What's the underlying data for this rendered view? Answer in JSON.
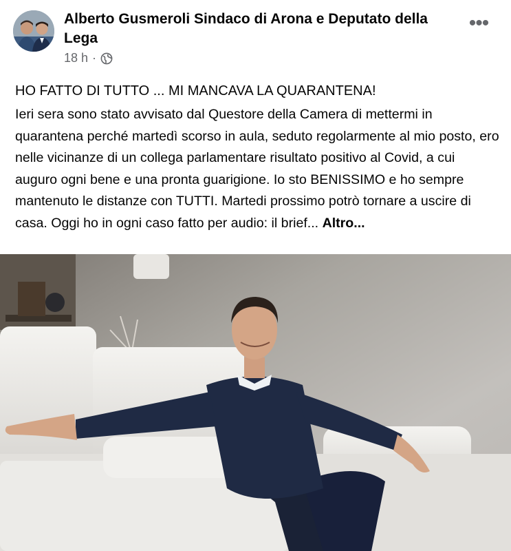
{
  "post": {
    "author": "Alberto Gusmeroli Sindaco di Arona e Deputato della Lega",
    "time": "18 h",
    "separator": "·",
    "headline": "HO FATTO DI TUTTO ... MI MANCAVA LA QUARANTENA!",
    "body": "Ieri sera  sono stato avvisato dal Questore della Camera di mettermi in quarantena perché martedì scorso in aula, seduto regolarmente al mio posto, ero nelle vicinanze di un collega parlamentare risultato positivo al Covid, a cui auguro ogni bene e una pronta guarigione. Io sto BENISSIMO e ho sempre mantenuto le distanze con TUTTI. Martedi prossimo potrò tornare a uscire di casa. Oggi ho in ogni caso fatto per audio: il brief... ",
    "see_more": "Altro...",
    "more_glyph": "•••"
  },
  "icons": {
    "privacy": "globe-icon",
    "menu": "more-options-icon"
  },
  "colors": {
    "text": "#050505",
    "secondary": "#65676b",
    "sweater": "#1f2a44"
  }
}
